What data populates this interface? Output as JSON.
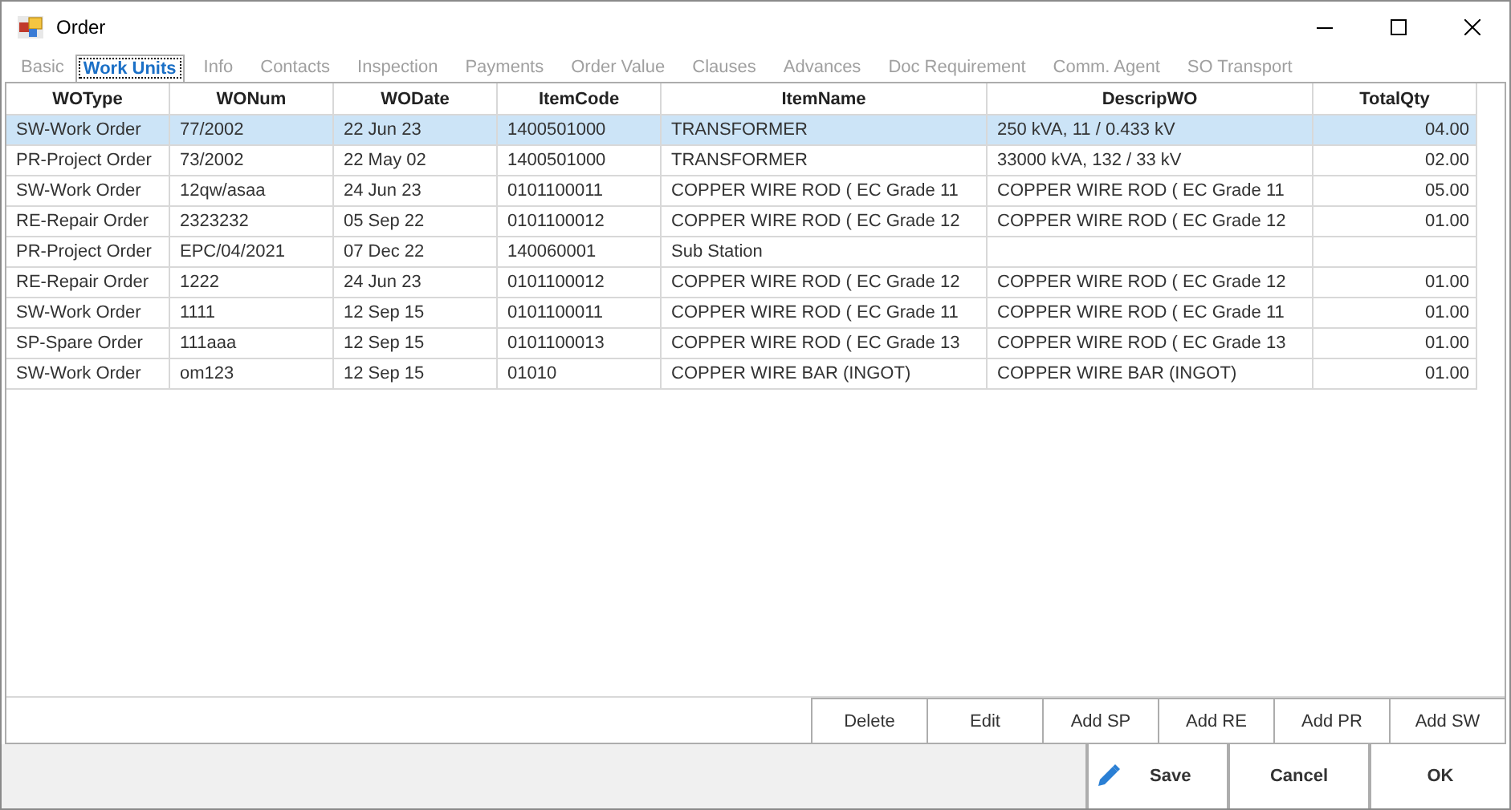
{
  "window": {
    "title": "Order"
  },
  "tabs": [
    {
      "label": "Basic",
      "selected": false
    },
    {
      "label": "Work Units",
      "selected": true
    },
    {
      "label": "Info",
      "selected": false
    },
    {
      "label": "Contacts",
      "selected": false
    },
    {
      "label": "Inspection",
      "selected": false
    },
    {
      "label": "Payments",
      "selected": false
    },
    {
      "label": "Order Value",
      "selected": false
    },
    {
      "label": "Clauses",
      "selected": false
    },
    {
      "label": "Advances",
      "selected": false
    },
    {
      "label": "Doc Requirement",
      "selected": false
    },
    {
      "label": "Comm. Agent",
      "selected": false
    },
    {
      "label": "SO Transport",
      "selected": false
    }
  ],
  "table": {
    "columns": [
      "WOType",
      "WONum",
      "WODate",
      "ItemCode",
      "ItemName",
      "DescripWO",
      "TotalQty"
    ],
    "rows": [
      {
        "selected": true,
        "cells": [
          "SW-Work Order",
          "77/2002",
          "22 Jun 23",
          "1400501000",
          "TRANSFORMER",
          "250 kVA, 11 / 0.433 kV",
          "04.00"
        ]
      },
      {
        "selected": false,
        "cells": [
          "PR-Project Order",
          "73/2002",
          "22 May 02",
          "1400501000",
          "TRANSFORMER",
          "33000 kVA, 132 / 33 kV",
          "02.00"
        ]
      },
      {
        "selected": false,
        "cells": [
          "SW-Work Order",
          "12qw/asaa",
          "24 Jun 23",
          "0101100011",
          "COPPER WIRE ROD ( EC Grade 11",
          "COPPER WIRE ROD ( EC Grade 11",
          "05.00"
        ]
      },
      {
        "selected": false,
        "cells": [
          "RE-Repair Order",
          "2323232",
          "05 Sep 22",
          "0101100012",
          "COPPER WIRE ROD ( EC Grade 12",
          "COPPER WIRE ROD ( EC Grade 12",
          "01.00"
        ]
      },
      {
        "selected": false,
        "cells": [
          "PR-Project Order",
          "EPC/04/2021",
          "07 Dec 22",
          "140060001",
          "Sub Station",
          "",
          ""
        ]
      },
      {
        "selected": false,
        "cells": [
          "RE-Repair Order",
          "1222",
          "24 Jun 23",
          "0101100012",
          "COPPER WIRE ROD ( EC Grade 12",
          "COPPER WIRE ROD ( EC Grade 12",
          "01.00"
        ]
      },
      {
        "selected": false,
        "cells": [
          "SW-Work Order",
          "1111",
          "12 Sep 15",
          "0101100011",
          "COPPER WIRE ROD ( EC Grade 11",
          "COPPER WIRE ROD ( EC Grade 11",
          "01.00"
        ]
      },
      {
        "selected": false,
        "cells": [
          "SP-Spare Order",
          "111aaa",
          "12 Sep 15",
          "0101100013",
          "COPPER WIRE ROD ( EC Grade 13",
          "COPPER WIRE ROD ( EC Grade 13",
          "01.00"
        ]
      },
      {
        "selected": false,
        "cells": [
          "SW-Work Order",
          "om123",
          "12 Sep 15",
          "01010",
          "COPPER WIRE BAR (INGOT)",
          "COPPER WIRE BAR (INGOT)",
          "01.00"
        ]
      }
    ]
  },
  "grid_buttons": [
    "Delete",
    "Edit",
    "Add SP",
    "Add RE",
    "Add PR",
    "Add SW"
  ],
  "footer_buttons": [
    {
      "label": "Save",
      "kind": "icon"
    },
    {
      "label": "Cancel",
      "kind": "plain"
    },
    {
      "label": "OK",
      "kind": "plain"
    }
  ]
}
